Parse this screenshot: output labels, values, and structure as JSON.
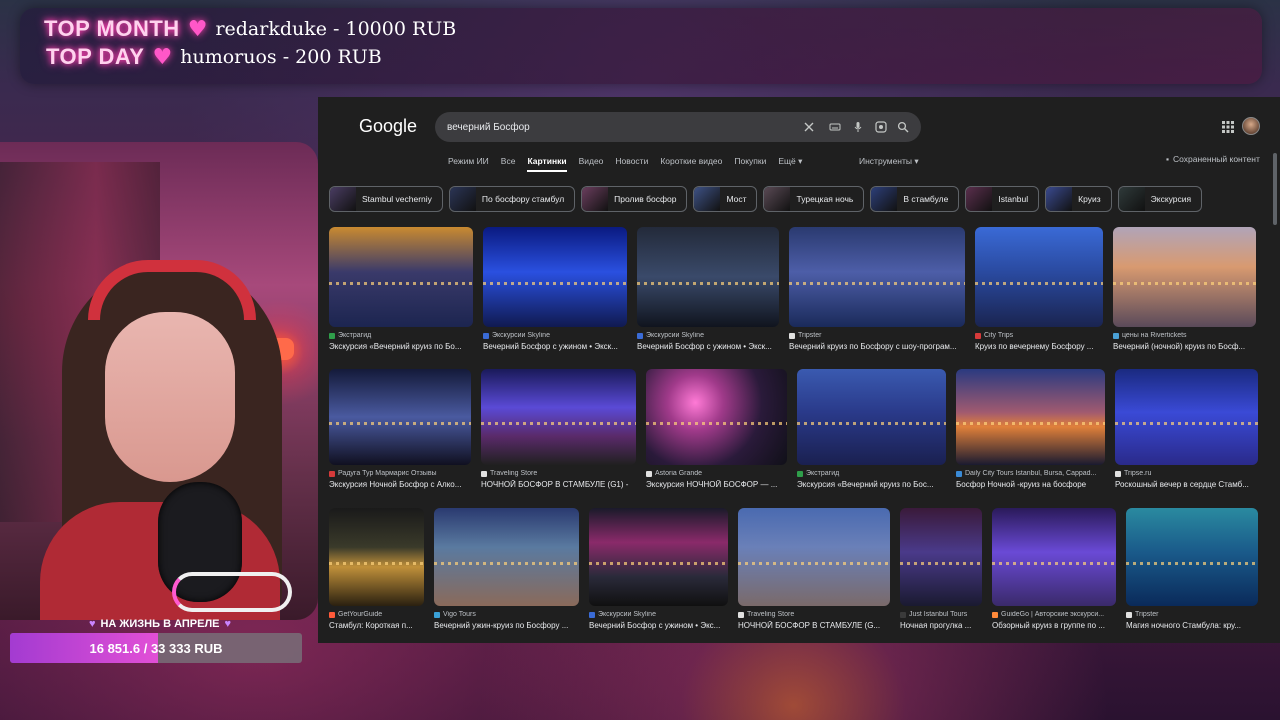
{
  "overlay": {
    "top_month_label": "TOP MONTH",
    "top_month_donor": "redarkduke - 10000 RUB",
    "top_day_label": "TOP DAY",
    "top_day_donor": "humoruos - 200 RUB",
    "goal_title": "НА ЖИЗНЬ В АПРЕЛЕ",
    "goal_progress_text": "16 851.6 / 33 333 RUB",
    "goal_fraction": 0.5056
  },
  "google": {
    "logo": "Google",
    "query": "вечерний Босфор",
    "icons": [
      "close-icon",
      "keyboard-icon",
      "mic-icon",
      "lens-icon",
      "search-icon"
    ],
    "tabs": [
      {
        "label": "Режим ИИ",
        "active": false
      },
      {
        "label": "Все",
        "active": false
      },
      {
        "label": "Картинки",
        "active": true
      },
      {
        "label": "Видео",
        "active": false
      },
      {
        "label": "Новости",
        "active": false
      },
      {
        "label": "Короткие видео",
        "active": false
      },
      {
        "label": "Покупки",
        "active": false
      },
      {
        "label": "Ещё ▾",
        "active": false
      }
    ],
    "tools_label": "Инструменты ▾",
    "saved_label": "Сохраненный контент",
    "chips": [
      {
        "label": "Stambul vecherniy",
        "color": "#4a3d63"
      },
      {
        "label": "По босфору стамбул",
        "color": "#2b3556"
      },
      {
        "label": "Пролив босфор",
        "color": "#6b3e5e"
      },
      {
        "label": "Мост",
        "color": "#3e5286"
      },
      {
        "label": "Турецкая ночь",
        "color": "#5a4a55"
      },
      {
        "label": "В стамбуле",
        "color": "#2d3f7a"
      },
      {
        "label": "Istanbul",
        "color": "#5b2f4d"
      },
      {
        "label": "Круиз",
        "color": "#3a4a90"
      },
      {
        "label": "Экскурсия",
        "color": "#2f3a3a"
      }
    ],
    "rows": [
      [
        {
          "source": "Экстрагид",
          "caption": "Экскурсия «Вечерний круиз по Бо...",
          "fav": "#2f9e4a",
          "bg": "linear-gradient(180deg,#c98a30 0%,#3a3a6a 45%,#1c2550 100%)"
        },
        {
          "source": "Экскурсии Skyline",
          "caption": "Вечерний Босфор с ужином • Экск...",
          "fav": "#3a6bd6",
          "bg": "linear-gradient(180deg,#0a1a80 0%,#2a50e0 45%,#101a50 100%)"
        },
        {
          "source": "Экскурсии Skyline",
          "caption": "Вечерний Босфор с ужином • Экск...",
          "fav": "#3a6bd6",
          "bg": "linear-gradient(180deg,#232a3a 0%,#3a4a6a 50%,#10141e 100%)"
        },
        {
          "source": "Tripster",
          "caption": "Вечерний круиз по Босфору с шоу-програм...",
          "fav": "#e0e0e0",
          "bg": "linear-gradient(180deg,#2a3a70 0%,#4d5ea8 45%,#1a2a5a 100%)"
        },
        {
          "source": "City Trips",
          "caption": "Круиз по вечернему Босфору ...",
          "fav": "#d63a3a",
          "bg": "linear-gradient(180deg,#3a6ad6 0%,#2a4aa0 45%,#1a2450 100%)"
        },
        {
          "source": "цены на Rivertickets",
          "caption": "Вечерний (ночной) круиз по Босф...",
          "fav": "#4aa0d6",
          "bg": "linear-gradient(180deg,#b0a4b8 0%,#d89a70 40%,#5a4a5a 100%)"
        }
      ],
      [
        {
          "source": "Радуга Тур Мармарис Отзывы",
          "caption": "Экскурсия Ночной Босфор с Алко...",
          "fav": "#d63a3a",
          "bg": "linear-gradient(180deg,#141a3a 0%,#4a5aa0 50%,#101020 100%)"
        },
        {
          "source": "Traveling Store",
          "caption": "НОЧНОЙ БОСФОР В СТАМБУЛЕ (G1) -",
          "fav": "#e0e0e0",
          "bg": "linear-gradient(180deg,#1a1a5a 0%,#5a4ad6 40%,#5a2a6a 70%,#202020 100%)"
        },
        {
          "source": "Astoria Grande",
          "caption": "Экскурсия НОЧНОЙ БОСФОР — ...",
          "fav": "#e0e0e0",
          "bg": "radial-gradient(circle at 35% 35%,#ff7ad6 0%,#a03a8a 25%,#2a1a3a 60%,#101018 100%)"
        },
        {
          "source": "Экстрагид",
          "caption": "Экскурсия «Вечерний круиз по Бос...",
          "fav": "#2f9e4a",
          "bg": "linear-gradient(180deg,#3a5ab0 0%,#2a3a8a 45%,#1a2050 100%)"
        },
        {
          "source": "Daily City Tours Istanbul, Bursa, Cappad...",
          "caption": "Босфор Ночной -круиз на босфоре",
          "fav": "#3a8ad6",
          "bg": "linear-gradient(180deg,#2a3a80 0%,#a05a70 45%,#e0803a 60%,#1a1a30 100%)"
        },
        {
          "source": "Tripse.ru",
          "caption": "Роскошный вечер в сердце Стамб...",
          "fav": "#e0e0e0",
          "bg": "linear-gradient(180deg,#1a2a80 0%,#3a4ad6 45%,#2a2a8a 100%)"
        }
      ],
      [
        {
          "source": "GetYourGuide",
          "caption": "Стамбул: Короткая п...",
          "fav": "#ff5a3a",
          "bg": "linear-gradient(180deg,#1a1a1a 0%,#3a3a2a 40%,#c0903a 60%,#2a2010 100%)"
        },
        {
          "source": "Vigo Tours",
          "caption": "Вечерний ужин-круиз по Босфору ...",
          "fav": "#3aa0d6",
          "bg": "linear-gradient(180deg,#2a3a70 0%,#5a7aa0 40%,#8a6a5a 100%)"
        },
        {
          "source": "Экскурсии Skyline",
          "caption": "Вечерний Босфор с ужином • Экс...",
          "fav": "#3a6bd6",
          "bg": "linear-gradient(180deg,#1a1a2a 0%,#8a2a6a 35%,#2a2a3a 70%,#101010 100%)"
        },
        {
          "source": "Traveling Store",
          "caption": "НОЧНОЙ БОСФОР В СТАМБУЛЕ (G...",
          "fav": "#e0e0e0",
          "bg": "linear-gradient(180deg,#4a6ab0 0%,#6a80b8 40%,#7a6a6a 100%)"
        },
        {
          "source": "Just Istanbul Tours",
          "caption": "Ночная прогулка ...",
          "fav": "#3a3a3a",
          "bg": "linear-gradient(180deg,#3a1a3a 0%,#4a3a8a 45%,#1a1a30 100%)"
        },
        {
          "source": "GuideGo | Авторские экскурси...",
          "caption": "Обзорный круиз в группе по ...",
          "fav": "#ff8a3a",
          "bg": "linear-gradient(180deg,#2a1a5a 0%,#6a4ad6 45%,#3a2a6a 100%)"
        },
        {
          "source": "Tripster",
          "caption": "Магия ночного Стамбула: кру...",
          "fav": "#e0e0e0",
          "bg": "linear-gradient(180deg,#2a8aa0 0%,#1a5a8a 45%,#0a2a5a 100%)"
        }
      ]
    ]
  }
}
